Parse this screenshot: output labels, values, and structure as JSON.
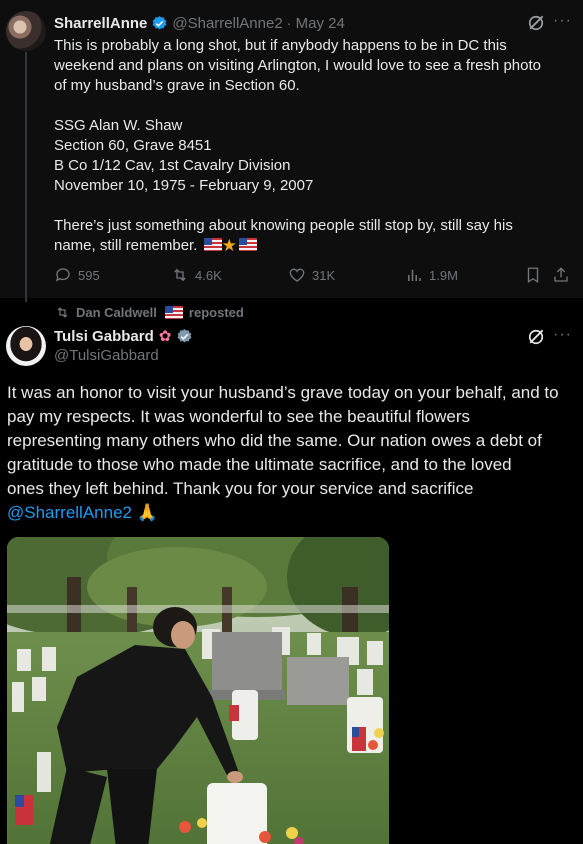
{
  "parent_tweet": {
    "display_name": "SharrellAnne",
    "handle": "@SharrellAnne2",
    "separator": "·",
    "date": "May 24",
    "lines": [
      "This is probably a long shot, but if anybody happens to be in DC this",
      "weekend and plans on visiting Arlington, I would love to see a fresh photo",
      "of my husband’s grave in Section 60.",
      "",
      "SSG Alan W. Shaw",
      "Section 60, Grave 8451",
      "B Co 1/12 Cav, 1st Cavalry Division",
      "November 10, 1975 - February 9, 2007",
      "",
      "There’s just something about knowing people still stop by, still say his",
      "name, still remember."
    ],
    "actions": {
      "replies": "595",
      "reposts": "4.6K",
      "likes": "31K",
      "views": "1.9M"
    }
  },
  "repost_banner": {
    "text": "Dan Caldwell",
    "suffix": "reposted"
  },
  "main_tweet": {
    "display_name": "Tulsi Gabbard",
    "handle": "@TulsiGabbard",
    "lines": [
      "It was an honor to visit your husband’s grave today on your behalf, and to",
      "pay my respects. It was wonderful to see the beautiful flowers",
      "representing many others who did the same. Our nation owes a debt of",
      "gratitude to those who made the ultimate sacrifice, and to the loved",
      "ones they left behind.  Thank you for your service and sacrifice"
    ],
    "mention": "@SharrellAnne2"
  },
  "icons": {
    "verified": "verified-badge-icon",
    "grok": "grok-icon",
    "more": "more-icon",
    "reply": "reply-icon",
    "repost": "repost-icon",
    "like": "like-icon",
    "views": "views-icon",
    "bookmark": "bookmark-icon",
    "share": "share-icon"
  },
  "colors": {
    "accent": "#1d9bf0",
    "muted": "#71767b",
    "text": "#e7e9ea"
  }
}
